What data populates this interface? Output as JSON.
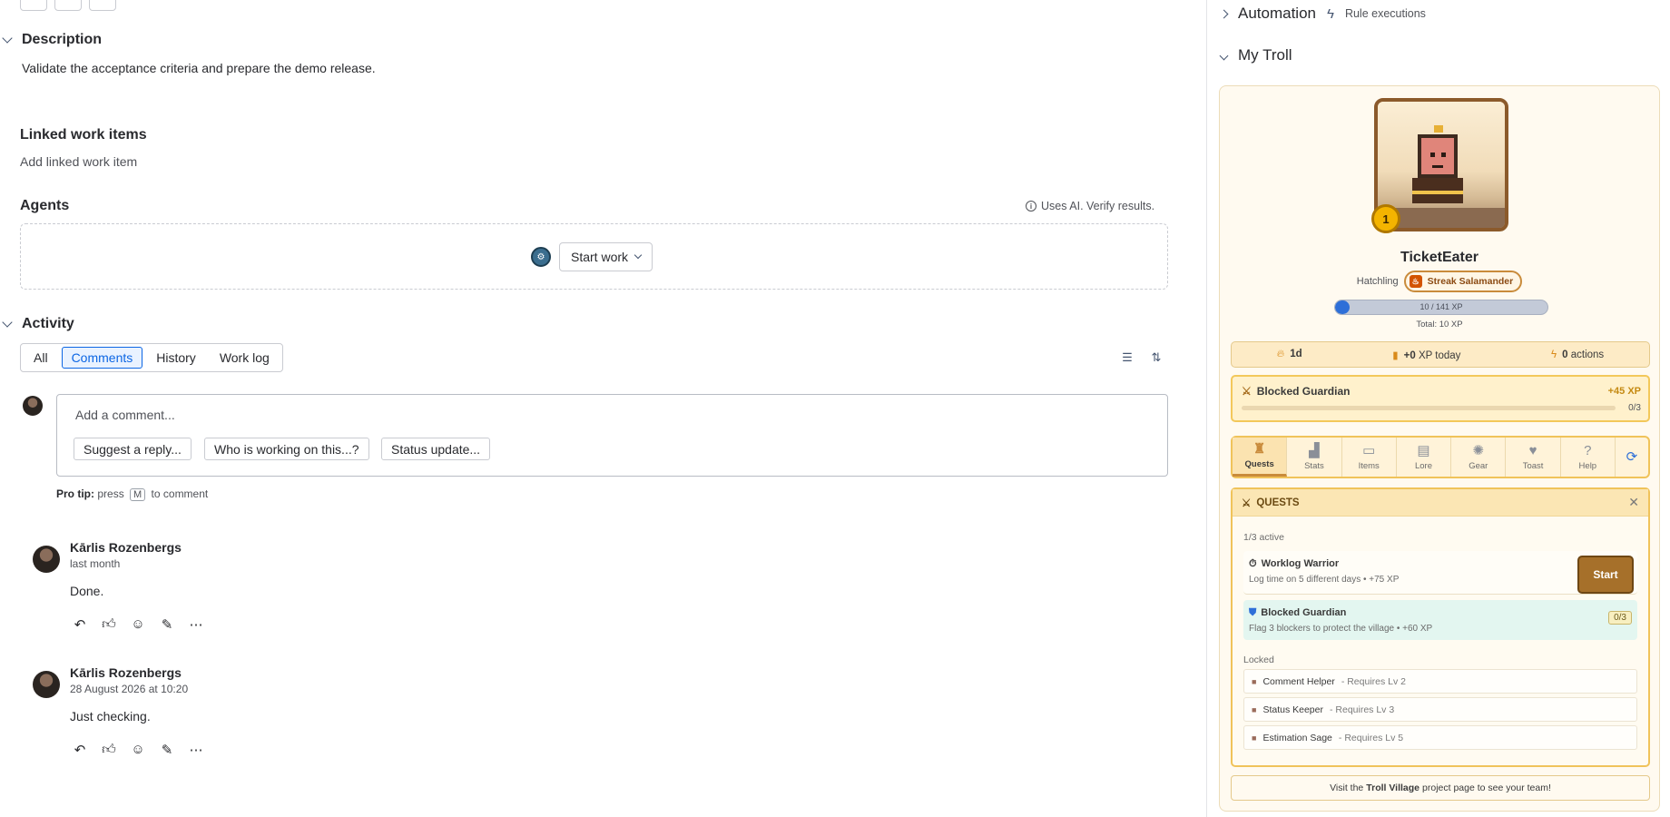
{
  "description": {
    "heading": "Description",
    "text": "Validate the acceptance criteria and prepare the demo release."
  },
  "linked": {
    "heading": "Linked work items",
    "add_label": "Add linked work item"
  },
  "agents": {
    "heading": "Agents",
    "ai_note": "Uses AI. Verify results.",
    "start_label": "Start work"
  },
  "activity": {
    "heading": "Activity",
    "tabs": [
      "All",
      "Comments",
      "History",
      "Work log"
    ],
    "active_tab": "Comments",
    "comment_placeholder": "Add a comment...",
    "quick_replies": [
      "Suggest a reply...",
      "Who is working on this...?",
      "Status update..."
    ],
    "pro_tip_label": "Pro tip:",
    "pro_tip_press": "press",
    "pro_tip_key": "M",
    "pro_tip_suffix": "to comment"
  },
  "comments": [
    {
      "author": "Kārlis Rozenbergs",
      "time": "last month",
      "body": "Done."
    },
    {
      "author": "Kārlis Rozenbergs",
      "time": "28 August 2026 at 10:20",
      "body": "Just checking."
    }
  ],
  "right_panel": {
    "automation_title": "Automation",
    "automation_sub": "Rule executions",
    "my_troll_title": "My Troll"
  },
  "troll": {
    "level": "1",
    "name": "TicketEater",
    "rank": "Hatchling",
    "streak_badge": "Streak Salamander",
    "xp_text": "10 / 141 XP",
    "xp_progress": 0.07,
    "total_xp": "Total: 10 XP",
    "stats": {
      "streak": "1d",
      "xp_today_value": "+0",
      "xp_today_label": "XP today",
      "actions_value": "0",
      "actions_label": "actions"
    },
    "active_quest": {
      "name": "Blocked Guardian",
      "xp": "+45 XP",
      "progress": "0/3"
    },
    "nav_tabs": [
      "Quests",
      "Stats",
      "Items",
      "Lore",
      "Gear",
      "Toast",
      "Help"
    ],
    "nav_active": "Quests",
    "quests": {
      "title": "QUESTS",
      "active_count": "1/3 active",
      "items": [
        {
          "title": "Worklog Warrior",
          "desc": "Log time on 5 different days • +75 XP",
          "action": "Start"
        },
        {
          "title": "Blocked Guardian",
          "desc": "Flag 3 blockers to protect the village • +60 XP",
          "progress": "0/3"
        }
      ],
      "locked_label": "Locked",
      "locked": [
        {
          "name": "Comment Helper",
          "req": "- Requires Lv 2"
        },
        {
          "name": "Status Keeper",
          "req": "- Requires Lv 3"
        },
        {
          "name": "Estimation Sage",
          "req": "- Requires Lv 5"
        }
      ]
    },
    "village": {
      "pre": "Visit the",
      "name": "Troll Village",
      "post": "project page to see your team!"
    }
  },
  "colors": {
    "accent": "#0c66e4",
    "troll_gold": "#f4b400",
    "quest_border": "#f0c35a"
  }
}
